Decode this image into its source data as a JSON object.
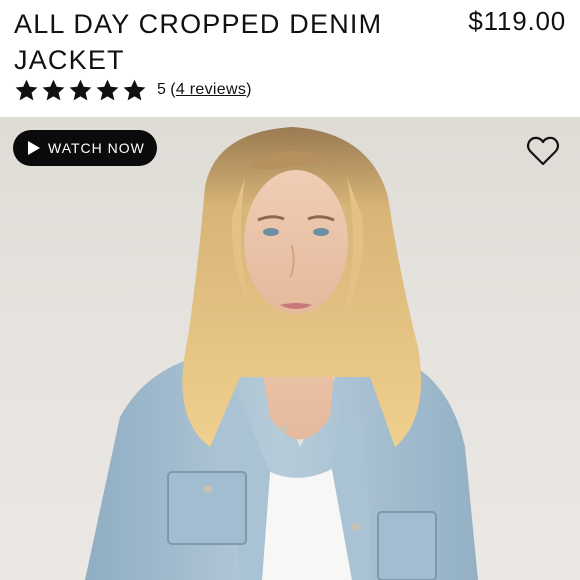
{
  "product": {
    "title": "ALL DAY CROPPED DENIM JACKET",
    "price": "$119.00",
    "rating_score": "5",
    "reviews_open": "(",
    "reviews_text": "4 reviews",
    "reviews_close": ")",
    "stars": 5
  },
  "media": {
    "watch_label": "WATCH NOW",
    "watch_icon": "play-icon",
    "favorite_icon": "heart-outline-icon",
    "image_alt": "Model wearing light wash cropped denim jacket over white tank"
  },
  "colors": {
    "text": "#111111",
    "button_bg": "#0b0b0b",
    "star": "#111111",
    "denim": "#a9c3d4",
    "backdrop": "#e3e0db"
  }
}
